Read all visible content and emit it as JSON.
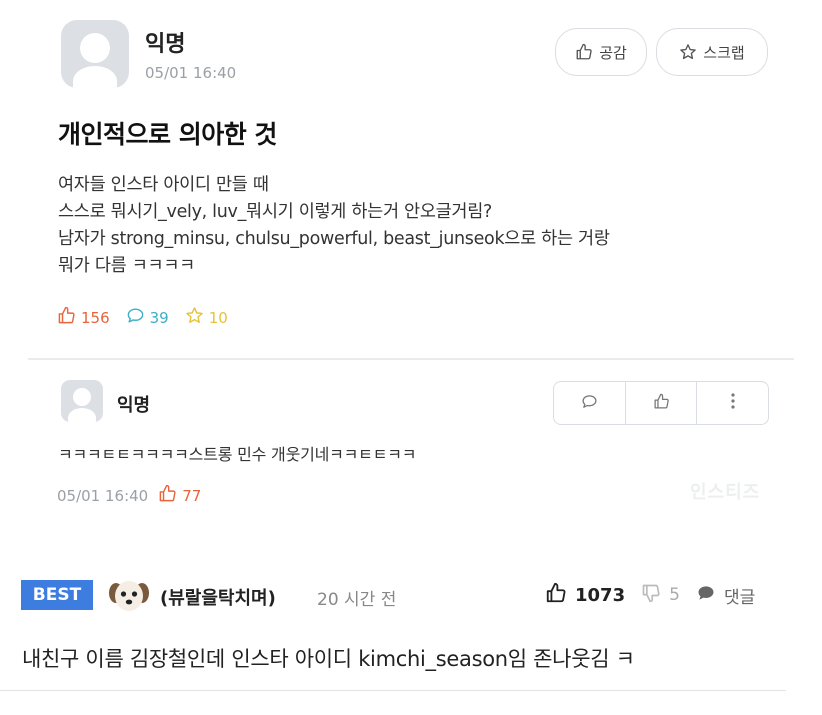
{
  "post": {
    "author": "익명",
    "timestamp": "05/01 16:40",
    "empathy_label": "공감",
    "scrap_label": "스크랩",
    "title": "개인적으로 의아한 것",
    "body_lines": [
      "여자들 인스타 아이디 만들 때",
      "스스로 뭐시기_vely, luv_뭐시기 이렇게 하는거 안오글거림?",
      "남자가 strong_minsu, chulsu_powerful, beast_junseok으로 하는 거랑",
      "뭐가 다름 ㅋㅋㅋㅋ"
    ],
    "stats": {
      "likes": "156",
      "comments": "39",
      "scraps": "10"
    },
    "stat_colors": {
      "likes": "#e8643c",
      "comments": "#3cb0c8",
      "scraps": "#e8c23c"
    }
  },
  "reply": {
    "author": "익명",
    "body": "ㅋㅋㅋㅌㅌㅋㅋㅋㅋ스트롱 민수 개웃기네ㅋㅋㅌㅌㅋㅋ",
    "timestamp": "05/01 16:40",
    "likes": "77",
    "watermark": "인스티즈"
  },
  "best_comment": {
    "badge": "BEST",
    "nickname": "(뷰랄을탁치며)",
    "time": "20 시간 전",
    "likes": "1073",
    "dislikes": "5",
    "reply_label": "댓글",
    "text": "내친구 이름 김장철인데 인스타 아이디 kimchi_season임 존나웃김 ㅋ"
  },
  "colors": {
    "best_badge": "#3d7de0",
    "avatar_bg": "#dcdfe3"
  }
}
